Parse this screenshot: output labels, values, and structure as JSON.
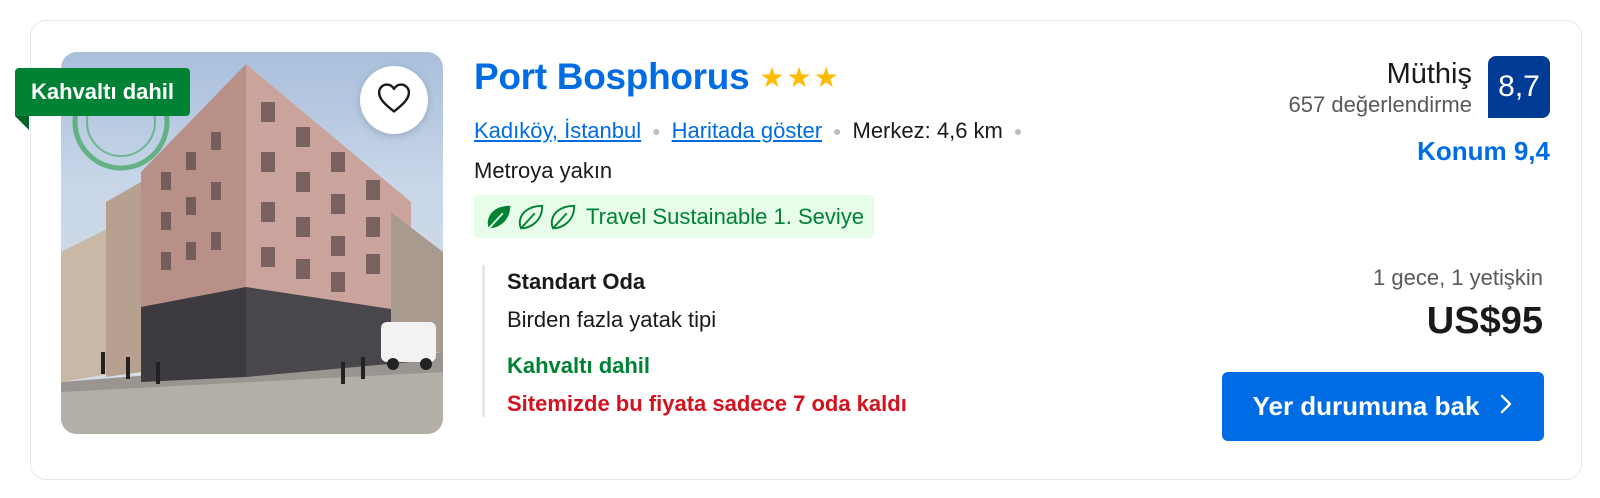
{
  "card": {
    "breakfast_badge": "Kahvaltı dahil",
    "hotel_name": "Port Bosphorus",
    "star_count": 3,
    "location_link": "Kadıköy, İstanbul",
    "map_link": "Haritada göster",
    "distance": "Merkez: 4,6 km",
    "metro": "Metroya yakın",
    "sustainability": "Travel Sustainable 1. Seviye",
    "room": {
      "title": "Standart Oda",
      "beds": "Birden fazla yatak tipi",
      "breakfast": "Kahvaltı dahil",
      "availability": "Sitemizde bu fiyata sadece 7 oda kaldı"
    },
    "review": {
      "word": "Müthiş",
      "count": "657 değerlendirme",
      "score": "8,7",
      "location_score": "Konum 9,4"
    },
    "price": {
      "nights": "1 gece, 1 yetişkin",
      "amount": "US$95"
    },
    "cta": "Yer durumuna bak"
  },
  "icons": [
    "heart-icon",
    "star-icon",
    "leaf-icon",
    "chevron-right-icon"
  ],
  "colors": {
    "brand_blue": "#006ce4",
    "score_blue": "#003b95",
    "green": "#008234",
    "red": "#d4111e",
    "star_yellow": "#febb02"
  }
}
